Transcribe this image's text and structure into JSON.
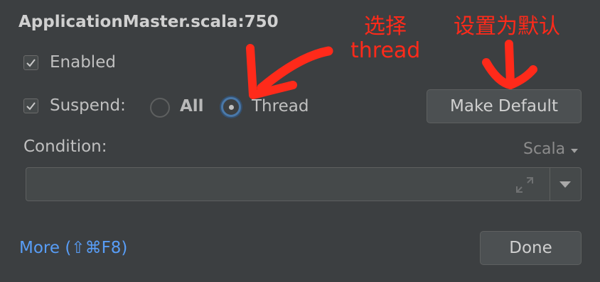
{
  "dialog": {
    "title": "ApplicationMaster.scala:750",
    "enabled_label": "Enabled",
    "suspend_label": "Suspend:",
    "suspend_options": [
      {
        "label": "All",
        "selected": false
      },
      {
        "label": "Thread",
        "selected": true
      }
    ],
    "make_default_label": "Make Default",
    "condition_label": "Condition:",
    "language_selector": "Scala",
    "more_link": "More (⇧⌘F8)",
    "done_label": "Done"
  },
  "annotations": {
    "select_text_line1": "选择",
    "select_text_line2": "thread",
    "make_default_text": "设置为默认",
    "color": "#ff2a1a"
  },
  "colors": {
    "background": "#3c3f41",
    "link": "#589df6",
    "radio_focus": "#4a78a8"
  }
}
